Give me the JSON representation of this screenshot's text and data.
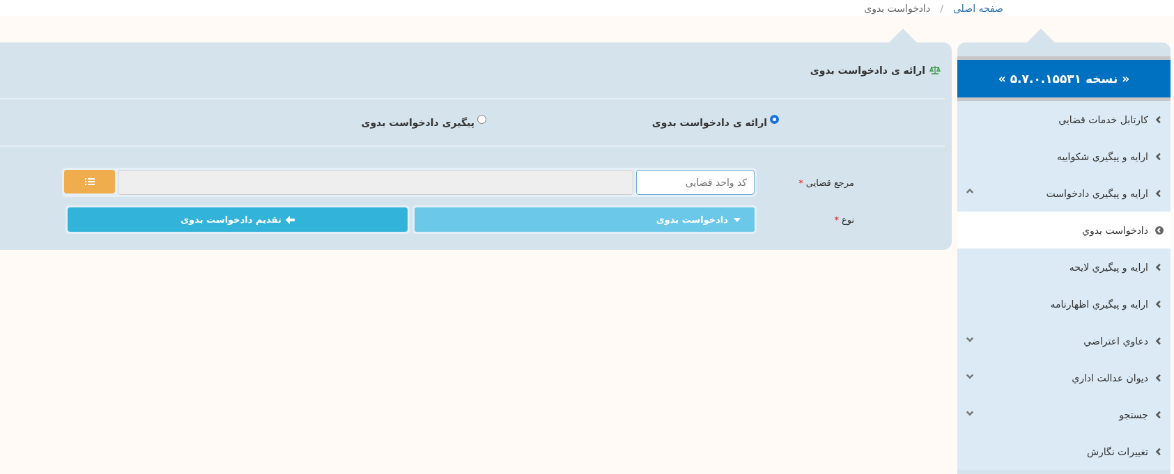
{
  "breadcrumb": [
    {
      "label": "صفحه اصلی",
      "kind": "link",
      "separator": "/"
    },
    {
      "label": "دادخواست بدوی",
      "kind": "current"
    }
  ],
  "sidebar": {
    "version": "« نسخه ۵.۷.۰.۱۵۵۳۱ »",
    "items": [
      {
        "label": "كارتابل خدمات قضايي"
      },
      {
        "label": "ارايه و پيگيري شكواييه"
      },
      {
        "label": "ارايه و پيگيري دادخواست",
        "expanded": true,
        "children": [
          {
            "label": "دادخواست بدوي",
            "selected": true
          }
        ]
      },
      {
        "label": "ارايه و پيگيري لايحه"
      },
      {
        "label": "ارايه و پيگيري اظهارنامه"
      },
      {
        "label": "دعاوي اعتراضي",
        "expanded": false
      },
      {
        "label": "ديوان عدالت اداري",
        "expanded": false
      },
      {
        "label": "جستجو",
        "expanded": false
      },
      {
        "label": "تغييرات نگارش"
      }
    ]
  },
  "panel": {
    "title": "ارائه ی دادخواست بدوی",
    "options": [
      {
        "label": "ارائه ی دادخواست بدوی",
        "selected": true
      },
      {
        "label": "پیگیری دادخواست بدوی",
        "selected": false
      }
    ],
    "fields": [
      {
        "label": "مرجع قضایی",
        "required_mark": "*",
        "placeholder": "کد واحد قضایی"
      },
      {
        "label": "نوع",
        "required_mark": "*",
        "value": "دادخواست بدوی"
      }
    ],
    "submit": "تقدیم دادخواست بدوی"
  }
}
